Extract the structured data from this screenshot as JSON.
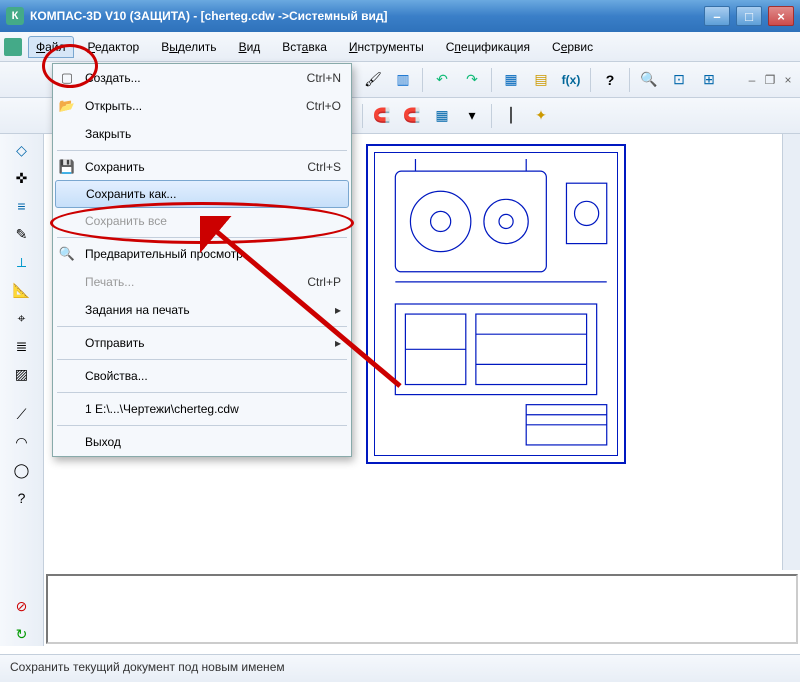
{
  "title": "КОМПАС-3D V10 (ЗАЩИТА) - [cherteg.cdw ->Системный вид]",
  "menubar": {
    "file_menu": "Файл",
    "items": [
      "Файл",
      "Редактор",
      "Выделить",
      "Вид",
      "Вставка",
      "Инструменты",
      "Спецификация",
      "Сервис"
    ]
  },
  "dropdown": {
    "create": {
      "label": "Создать...",
      "shortcut": "Ctrl+N"
    },
    "open": {
      "label": "Открыть...",
      "shortcut": "Ctrl+O"
    },
    "close": {
      "label": "Закрыть"
    },
    "save": {
      "label": "Сохранить",
      "shortcut": "Ctrl+S"
    },
    "saveas": {
      "label": "Сохранить как..."
    },
    "saveall": {
      "label": "Сохранить все"
    },
    "preview": {
      "label": "Предварительный просмотр"
    },
    "print": {
      "label": "Печать...",
      "shortcut": "Ctrl+P"
    },
    "printjobs": {
      "label": "Задания на печать"
    },
    "send": {
      "label": "Отправить"
    },
    "props": {
      "label": "Свойства..."
    },
    "recent": {
      "label": "1 E:\\...\\Чертежи\\cherteg.cdw"
    },
    "exit": {
      "label": "Выход"
    }
  },
  "statusbar": "Сохранить текущий документ под новым именем",
  "toolbar": {
    "brush": "brush",
    "window": "window",
    "undo": "undo",
    "redo": "redo",
    "lib": "lib",
    "democ": "democ",
    "fx": "f(x)",
    "help": "help",
    "zoomin": "zoom+",
    "zoomout": "zoom–",
    "zoomfit": "zoom",
    "magnet1": "magnet",
    "magnet2": "magnet",
    "grid": "grid",
    "pick": "pick",
    "line": "line",
    "wand": "wand"
  }
}
